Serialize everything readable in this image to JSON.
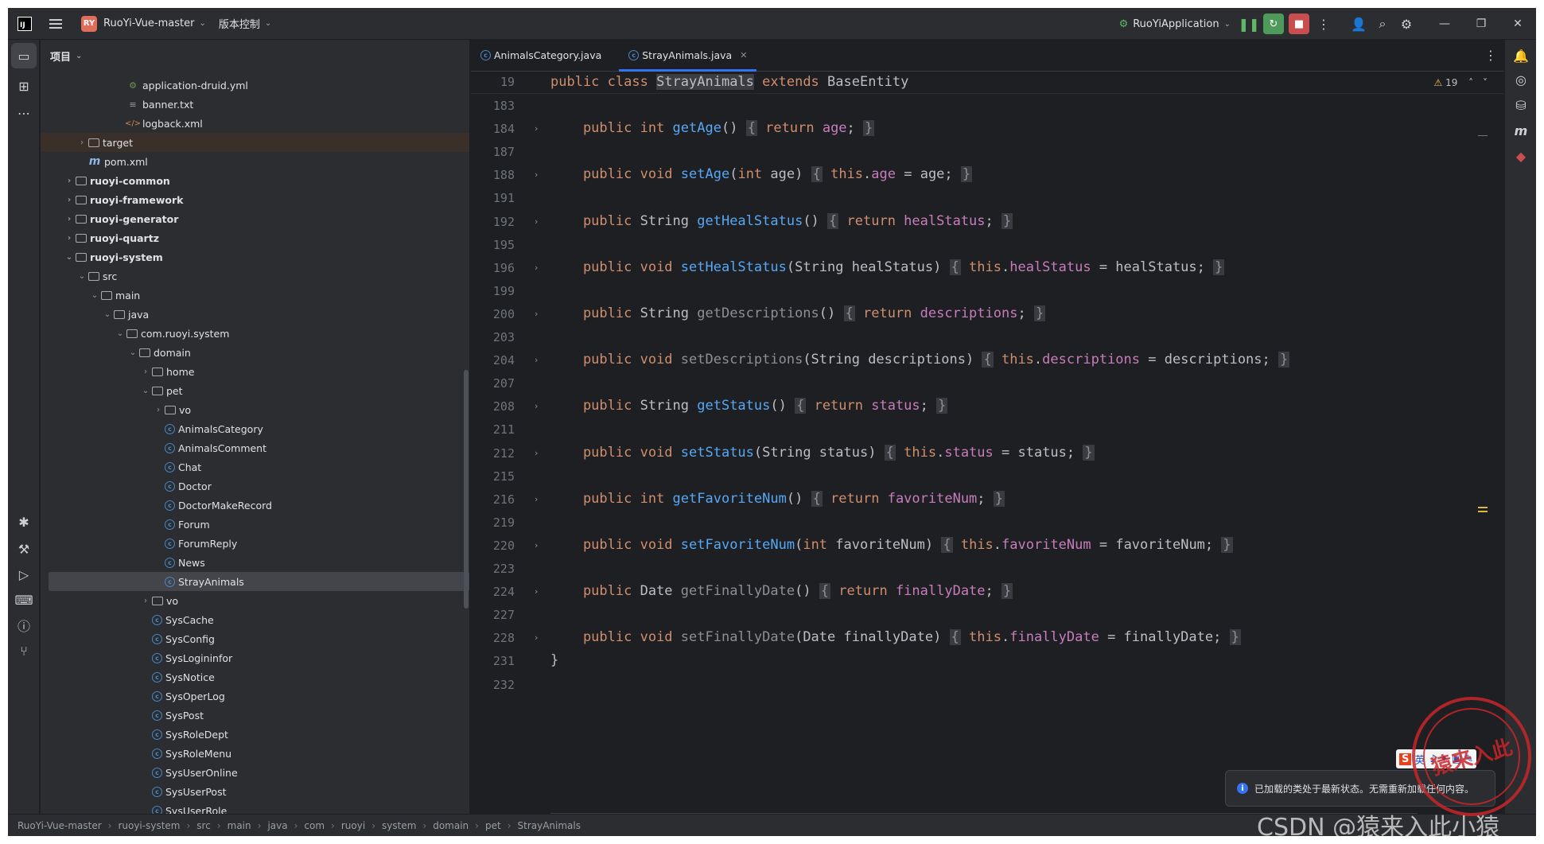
{
  "titlebar": {
    "logo_text": "IJ",
    "project_badge": "RY",
    "project_name": "RuoYi-Vue-master",
    "vcs_menu": "版本控制",
    "run_config": "RuoYiApplication"
  },
  "project_panel": {
    "title": "项目",
    "tree": [
      {
        "label": "application-druid.yml",
        "depth": 6,
        "icon": "yml",
        "arrow": ""
      },
      {
        "label": "banner.txt",
        "depth": 6,
        "icon": "file",
        "arrow": ""
      },
      {
        "label": "logback.xml",
        "depth": 6,
        "icon": "xml",
        "arrow": ""
      },
      {
        "label": "target",
        "depth": 3,
        "icon": "folder",
        "arrow": "›",
        "style": "sel-dir"
      },
      {
        "label": "pom.xml",
        "depth": 3,
        "icon": "m",
        "arrow": ""
      },
      {
        "label": "ruoyi-common",
        "depth": 2,
        "icon": "folder",
        "arrow": "›",
        "style": "bold"
      },
      {
        "label": "ruoyi-framework",
        "depth": 2,
        "icon": "folder",
        "arrow": "›",
        "style": "bold"
      },
      {
        "label": "ruoyi-generator",
        "depth": 2,
        "icon": "folder",
        "arrow": "›",
        "style": "bold"
      },
      {
        "label": "ruoyi-quartz",
        "depth": 2,
        "icon": "folder",
        "arrow": "›",
        "style": "bold"
      },
      {
        "label": "ruoyi-system",
        "depth": 2,
        "icon": "folder",
        "arrow": "⌄",
        "style": "bold"
      },
      {
        "label": "src",
        "depth": 3,
        "icon": "folder",
        "arrow": "⌄"
      },
      {
        "label": "main",
        "depth": 4,
        "icon": "folder",
        "arrow": "⌄"
      },
      {
        "label": "java",
        "depth": 5,
        "icon": "folder",
        "arrow": "⌄"
      },
      {
        "label": "com.ruoyi.system",
        "depth": 6,
        "icon": "folder",
        "arrow": "⌄"
      },
      {
        "label": "domain",
        "depth": 7,
        "icon": "folder",
        "arrow": "⌄"
      },
      {
        "label": "home",
        "depth": 8,
        "icon": "folder",
        "arrow": "›"
      },
      {
        "label": "pet",
        "depth": 8,
        "icon": "folder",
        "arrow": "⌄"
      },
      {
        "label": "vo",
        "depth": 9,
        "icon": "folder",
        "arrow": "›"
      },
      {
        "label": "AnimalsCategory",
        "depth": 9,
        "icon": "cls",
        "arrow": ""
      },
      {
        "label": "AnimalsComment",
        "depth": 9,
        "icon": "cls",
        "arrow": ""
      },
      {
        "label": "Chat",
        "depth": 9,
        "icon": "cls",
        "arrow": ""
      },
      {
        "label": "Doctor",
        "depth": 9,
        "icon": "cls",
        "arrow": ""
      },
      {
        "label": "DoctorMakeRecord",
        "depth": 9,
        "icon": "cls",
        "arrow": ""
      },
      {
        "label": "Forum",
        "depth": 9,
        "icon": "cls",
        "arrow": ""
      },
      {
        "label": "ForumReply",
        "depth": 9,
        "icon": "cls",
        "arrow": ""
      },
      {
        "label": "News",
        "depth": 9,
        "icon": "cls",
        "arrow": ""
      },
      {
        "label": "StrayAnimals",
        "depth": 9,
        "icon": "cls",
        "arrow": "",
        "style": "selected"
      },
      {
        "label": "vo",
        "depth": 8,
        "icon": "folder",
        "arrow": "›"
      },
      {
        "label": "SysCache",
        "depth": 8,
        "icon": "cls",
        "arrow": ""
      },
      {
        "label": "SysConfig",
        "depth": 8,
        "icon": "cls",
        "arrow": ""
      },
      {
        "label": "SysLogininfor",
        "depth": 8,
        "icon": "cls",
        "arrow": ""
      },
      {
        "label": "SysNotice",
        "depth": 8,
        "icon": "cls",
        "arrow": ""
      },
      {
        "label": "SysOperLog",
        "depth": 8,
        "icon": "cls",
        "arrow": ""
      },
      {
        "label": "SysPost",
        "depth": 8,
        "icon": "cls",
        "arrow": ""
      },
      {
        "label": "SysRoleDept",
        "depth": 8,
        "icon": "cls",
        "arrow": ""
      },
      {
        "label": "SysRoleMenu",
        "depth": 8,
        "icon": "cls",
        "arrow": ""
      },
      {
        "label": "SysUserOnline",
        "depth": 8,
        "icon": "cls",
        "arrow": ""
      },
      {
        "label": "SysUserPost",
        "depth": 8,
        "icon": "cls",
        "arrow": ""
      },
      {
        "label": "SysUserRole",
        "depth": 8,
        "icon": "cls",
        "arrow": ""
      }
    ]
  },
  "editor": {
    "tabs": [
      {
        "label": "AnimalsCategory.java",
        "active": false
      },
      {
        "label": "StrayAnimals.java",
        "active": true
      }
    ],
    "warning_count": "19",
    "sticky": {
      "line": "19",
      "tokens": [
        [
          "kw",
          "public "
        ],
        [
          "kw",
          "class "
        ],
        [
          "hl-class",
          "StrayAnimals"
        ],
        [
          "kw",
          " extends "
        ],
        [
          "type",
          "BaseEntity"
        ]
      ]
    },
    "lines": [
      {
        "n": "183",
        "fold": false,
        "tokens": []
      },
      {
        "n": "184",
        "fold": true,
        "tokens": [
          [
            "kw",
            "    public "
          ],
          [
            "kw",
            "int "
          ],
          [
            "fn",
            "getAge"
          ],
          [
            "type",
            "() "
          ],
          [
            "brace",
            "{"
          ],
          [
            "kw",
            " return "
          ],
          [
            "fld",
            "age"
          ],
          [
            "type",
            ";"
          ],
          [
            "type",
            " "
          ],
          [
            "brace",
            "}"
          ]
        ]
      },
      {
        "n": "187",
        "fold": false,
        "tokens": []
      },
      {
        "n": "188",
        "fold": true,
        "tokens": [
          [
            "kw",
            "    public "
          ],
          [
            "kw",
            "void "
          ],
          [
            "fn",
            "setAge"
          ],
          [
            "type",
            "("
          ],
          [
            "kw",
            "int "
          ],
          [
            "type",
            "age) "
          ],
          [
            "brace",
            "{"
          ],
          [
            "kw",
            " this"
          ],
          [
            "type",
            "."
          ],
          [
            "fld",
            "age"
          ],
          [
            "type",
            " = age; "
          ],
          [
            "brace",
            "}"
          ]
        ]
      },
      {
        "n": "191",
        "fold": false,
        "tokens": []
      },
      {
        "n": "192",
        "fold": true,
        "tokens": [
          [
            "kw",
            "    public "
          ],
          [
            "type",
            "String "
          ],
          [
            "fn",
            "getHealStatus"
          ],
          [
            "type",
            "() "
          ],
          [
            "brace",
            "{"
          ],
          [
            "kw",
            " return "
          ],
          [
            "fld",
            "healStatus"
          ],
          [
            "type",
            "; "
          ],
          [
            "brace",
            "}"
          ]
        ]
      },
      {
        "n": "195",
        "fold": false,
        "tokens": []
      },
      {
        "n": "196",
        "fold": true,
        "tokens": [
          [
            "kw",
            "    public "
          ],
          [
            "kw",
            "void "
          ],
          [
            "fn",
            "setHealStatus"
          ],
          [
            "type",
            "(String healStatus) "
          ],
          [
            "brace",
            "{"
          ],
          [
            "kw",
            " this"
          ],
          [
            "type",
            "."
          ],
          [
            "fld",
            "healStatus"
          ],
          [
            "type",
            " = healStatus; "
          ],
          [
            "brace",
            "}"
          ]
        ]
      },
      {
        "n": "199",
        "fold": false,
        "tokens": []
      },
      {
        "n": "200",
        "fold": true,
        "tokens": [
          [
            "kw",
            "    public "
          ],
          [
            "type",
            "String "
          ],
          [
            "fn-dim",
            "getDescriptions"
          ],
          [
            "type",
            "() "
          ],
          [
            "brace",
            "{"
          ],
          [
            "kw",
            " return "
          ],
          [
            "fld",
            "descriptions"
          ],
          [
            "type",
            "; "
          ],
          [
            "brace",
            "}"
          ]
        ]
      },
      {
        "n": "203",
        "fold": false,
        "tokens": []
      },
      {
        "n": "204",
        "fold": true,
        "tokens": [
          [
            "kw",
            "    public "
          ],
          [
            "kw",
            "void "
          ],
          [
            "fn-dim",
            "setDescriptions"
          ],
          [
            "type",
            "(String descriptions) "
          ],
          [
            "brace",
            "{"
          ],
          [
            "kw",
            " this"
          ],
          [
            "type",
            "."
          ],
          [
            "fld",
            "descriptions"
          ],
          [
            "type",
            " = descriptions; "
          ],
          [
            "brace",
            "}"
          ]
        ]
      },
      {
        "n": "207",
        "fold": false,
        "tokens": []
      },
      {
        "n": "208",
        "fold": true,
        "tokens": [
          [
            "kw",
            "    public "
          ],
          [
            "type",
            "String "
          ],
          [
            "fn",
            "getStatus"
          ],
          [
            "type",
            "() "
          ],
          [
            "brace",
            "{"
          ],
          [
            "kw",
            " return "
          ],
          [
            "fld",
            "status"
          ],
          [
            "type",
            "; "
          ],
          [
            "brace",
            "}"
          ]
        ]
      },
      {
        "n": "211",
        "fold": false,
        "tokens": []
      },
      {
        "n": "212",
        "fold": true,
        "tokens": [
          [
            "kw",
            "    public "
          ],
          [
            "kw",
            "void "
          ],
          [
            "fn",
            "setStatus"
          ],
          [
            "type",
            "(String status) "
          ],
          [
            "brace",
            "{"
          ],
          [
            "kw",
            " this"
          ],
          [
            "type",
            "."
          ],
          [
            "fld",
            "status"
          ],
          [
            "type",
            " = status; "
          ],
          [
            "brace",
            "}"
          ]
        ]
      },
      {
        "n": "215",
        "fold": false,
        "tokens": []
      },
      {
        "n": "216",
        "fold": true,
        "tokens": [
          [
            "kw",
            "    public "
          ],
          [
            "kw",
            "int "
          ],
          [
            "fn",
            "getFavoriteNum"
          ],
          [
            "type",
            "() "
          ],
          [
            "brace",
            "{"
          ],
          [
            "kw",
            " return "
          ],
          [
            "fld",
            "favoriteNum"
          ],
          [
            "type",
            "; "
          ],
          [
            "brace",
            "}"
          ]
        ]
      },
      {
        "n": "219",
        "fold": false,
        "tokens": []
      },
      {
        "n": "220",
        "fold": true,
        "tokens": [
          [
            "kw",
            "    public "
          ],
          [
            "kw",
            "void "
          ],
          [
            "fn",
            "setFavoriteNum"
          ],
          [
            "type",
            "("
          ],
          [
            "kw",
            "int "
          ],
          [
            "type",
            "favoriteNum) "
          ],
          [
            "brace",
            "{"
          ],
          [
            "kw",
            " this"
          ],
          [
            "type",
            "."
          ],
          [
            "fld",
            "favoriteNum"
          ],
          [
            "type",
            " = favoriteNum; "
          ],
          [
            "brace",
            "}"
          ]
        ]
      },
      {
        "n": "223",
        "fold": false,
        "tokens": []
      },
      {
        "n": "224",
        "fold": true,
        "tokens": [
          [
            "kw",
            "    public "
          ],
          [
            "type",
            "Date "
          ],
          [
            "fn-dim",
            "getFinallyDate"
          ],
          [
            "type",
            "() "
          ],
          [
            "brace",
            "{"
          ],
          [
            "kw",
            " return "
          ],
          [
            "fld",
            "finallyDate"
          ],
          [
            "type",
            "; "
          ],
          [
            "brace",
            "}"
          ]
        ]
      },
      {
        "n": "227",
        "fold": false,
        "tokens": []
      },
      {
        "n": "228",
        "fold": true,
        "tokens": [
          [
            "kw",
            "    public "
          ],
          [
            "kw",
            "void "
          ],
          [
            "fn-dim",
            "setFinallyDate"
          ],
          [
            "type",
            "(Date finallyDate) "
          ],
          [
            "brace",
            "{"
          ],
          [
            "kw",
            " this"
          ],
          [
            "type",
            "."
          ],
          [
            "fld",
            "finallyDate"
          ],
          [
            "type",
            " = finallyDate; "
          ],
          [
            "brace",
            "}"
          ]
        ]
      },
      {
        "n": "231",
        "fold": false,
        "tokens": [
          [
            "type",
            "}"
          ]
        ]
      },
      {
        "n": "232",
        "fold": false,
        "tokens": []
      }
    ]
  },
  "statusbar": {
    "crumbs": [
      "RuoYi-Vue-master",
      "ruoyi-system",
      "src",
      "main",
      "java",
      "com",
      "ruoyi",
      "system",
      "domain",
      "pet",
      "StrayAnimals"
    ]
  },
  "notification": {
    "text": "已加载的类处于最新状态。无需重新加载任何内容。"
  },
  "overlay": {
    "ime_label": "英",
    "ime_s": "S",
    "stamp_text": "猿来入此",
    "watermark": "CSDN @猿来入此小猿"
  },
  "colors": {
    "keyword": "#cf8e6d",
    "method": "#56a8f5",
    "field": "#c77dbb",
    "accent": "#3574f0"
  }
}
